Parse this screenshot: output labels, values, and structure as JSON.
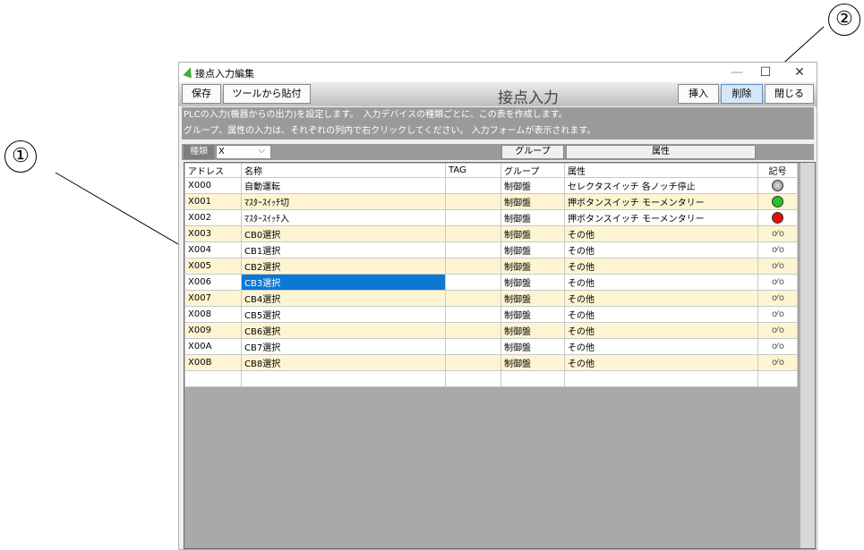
{
  "callouts": [
    "①",
    "②"
  ],
  "window": {
    "title": "接点入力編集",
    "controls": {
      "minimize": "—",
      "maximize": "☐",
      "close": "✕"
    }
  },
  "toolbar": {
    "save": "保存",
    "paste_from_tool": "ツールから貼付",
    "title": "接点入力",
    "insert": "挿入",
    "delete": "削除",
    "close": "閉じる"
  },
  "info": {
    "line1": "PLCの入力(機器からの出力)を設定します。　入力デバイスの種類ごとに、この表を作成します。",
    "line2": "グループ、属性の入力は、それぞれの列内で右クリックしてください。 入力フォームが表示されます。"
  },
  "filter": {
    "type_label": "種類",
    "type_value": "X",
    "group_header": "グループ",
    "attr_header": "属性"
  },
  "table": {
    "columns": [
      "アドレス",
      "名称",
      "TAG",
      "グループ",
      "属性",
      "記号"
    ],
    "rows": [
      {
        "address": "X000",
        "name": "自動運転",
        "tag": "",
        "group": "制御盤",
        "attr": "セレクタスイッチ 各ノッチ停止",
        "symbol": "lamp-gray-icon"
      },
      {
        "address": "X001",
        "name": "ﾏｽﾀｰｽｲｯﾁ切",
        "tag": "",
        "group": "制御盤",
        "attr": "押ボタンスイッチ モーメンタリー",
        "symbol": "lamp-green-icon"
      },
      {
        "address": "X002",
        "name": "ﾏｽﾀｰｽｲｯﾁ入",
        "tag": "",
        "group": "制御盤",
        "attr": "押ボタンスイッチ モーメンタリー",
        "symbol": "lamp-red-icon"
      },
      {
        "address": "X003",
        "name": "CB0選択",
        "tag": "",
        "group": "制御盤",
        "attr": "その他",
        "symbol": "switch-contact-icon"
      },
      {
        "address": "X004",
        "name": "CB1選択",
        "tag": "",
        "group": "制御盤",
        "attr": "その他",
        "symbol": "switch-contact-icon"
      },
      {
        "address": "X005",
        "name": "CB2選択",
        "tag": "",
        "group": "制御盤",
        "attr": "その他",
        "symbol": "switch-contact-icon"
      },
      {
        "address": "X006",
        "name": "CB3選択",
        "tag": "",
        "group": "制御盤",
        "attr": "その他",
        "symbol": "switch-contact-icon",
        "selected": true
      },
      {
        "address": "X007",
        "name": "CB4選択",
        "tag": "",
        "group": "制御盤",
        "attr": "その他",
        "symbol": "switch-contact-icon"
      },
      {
        "address": "X008",
        "name": "CB5選択",
        "tag": "",
        "group": "制御盤",
        "attr": "その他",
        "symbol": "switch-contact-icon"
      },
      {
        "address": "X009",
        "name": "CB6選択",
        "tag": "",
        "group": "制御盤",
        "attr": "その他",
        "symbol": "switch-contact-icon"
      },
      {
        "address": "X00A",
        "name": "CB7選択",
        "tag": "",
        "group": "制御盤",
        "attr": "その他",
        "symbol": "switch-contact-icon"
      },
      {
        "address": "X00B",
        "name": "CB8選択",
        "tag": "",
        "group": "制御盤",
        "attr": "その他",
        "symbol": "switch-contact-icon"
      }
    ]
  },
  "colors": {
    "selection": "#0a78d4",
    "row_alt": "#fff4d2",
    "panel_gray": "#9a9a9a"
  }
}
